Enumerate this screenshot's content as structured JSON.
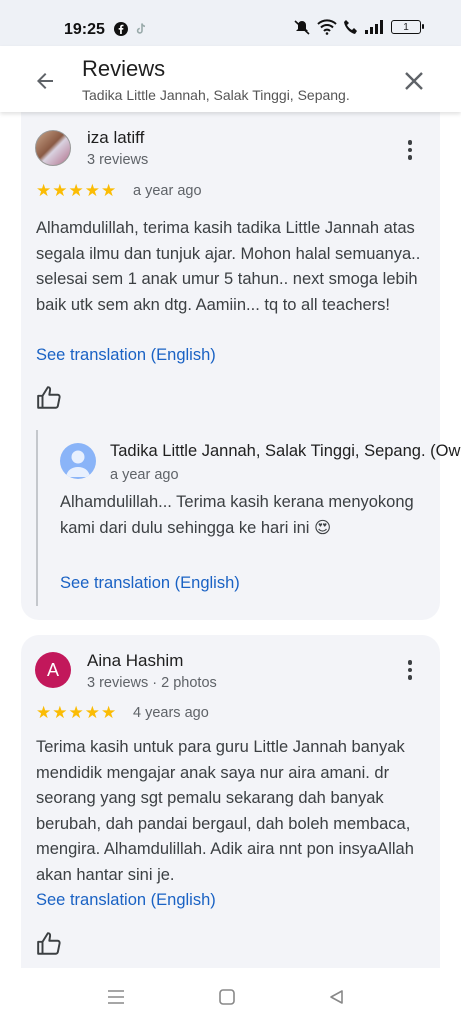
{
  "status_bar": {
    "time": "19:25",
    "battery": "1"
  },
  "header": {
    "title": "Reviews",
    "subtitle": "Tadika Little Jannah, Salak Tinggi, Sepang."
  },
  "reviews": [
    {
      "author": "iza latiff",
      "meta": "3 reviews",
      "rating": 5,
      "date": "a year ago",
      "text": "Alhamdulillah, terima kasih tadika Little Jannah atas segala ilmu dan tunjuk ajar. Mohon halal semuanya.. selesai sem 1 anak umur 5 tahun.. next smoga lebih baik utk sem akn dtg. Aamiin... tq to all teachers!",
      "translate_label": "See translation (English)",
      "owner_reply": {
        "name": "Tadika Little Jannah, Salak Tinggi, Sepang. (Owner)",
        "date": "a year ago",
        "text": "Alhamdulillah... Terima kasih kerana menyokong kami dari dulu sehingga ke hari ini 😍",
        "translate_label": "See translation (English)"
      }
    },
    {
      "author": "Aina Hashim",
      "avatar_letter": "A",
      "meta": "3 reviews · 2 photos",
      "rating": 5,
      "date": "4 years ago",
      "text": "Terima kasih untuk para guru Little Jannah banyak mendidik mengajar anak saya nur aira amani. dr seorang yang sgt pemalu sekarang dah banyak berubah, dah pandai bergaul, dah boleh membaca, mengira. Alhamdulillah. Adik aira nnt pon insyaAllah akan hantar sini je.",
      "translate_label": "See translation (English)"
    }
  ],
  "colors": {
    "star": "#fbbc04",
    "link": "#1a62c4",
    "avatar_letter_bg": "#c2185b",
    "card_bg": "#f3f4f8"
  }
}
